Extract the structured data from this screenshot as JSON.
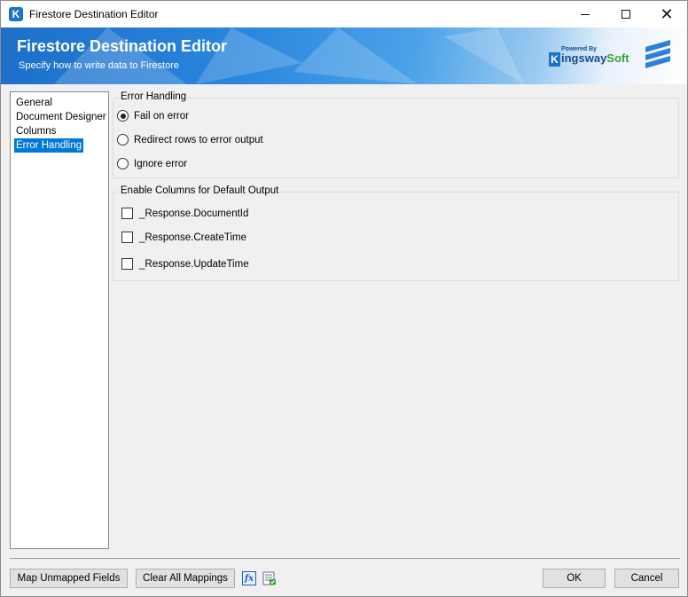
{
  "window": {
    "title": "Firestore Destination Editor",
    "app_icon_letter": "K",
    "controls": {
      "minimize": "—",
      "maximize": "☐",
      "close": "✕"
    }
  },
  "banner": {
    "title": "Firestore Destination Editor",
    "subtitle": "Specify how to write data to Firestore",
    "brand_powered": "Powered By",
    "brand_k": "K",
    "brand_name_a": "ingsway",
    "brand_name_b": "Soft"
  },
  "nav": {
    "items": [
      {
        "label": "General",
        "selected": false
      },
      {
        "label": "Document Designer",
        "selected": false
      },
      {
        "label": "Columns",
        "selected": false
      },
      {
        "label": "Error Handling",
        "selected": true
      }
    ]
  },
  "error_handling": {
    "legend": "Error Handling",
    "options": [
      {
        "label": "Fail on error",
        "checked": true
      },
      {
        "label": "Redirect rows to error output",
        "checked": false
      },
      {
        "label": "Ignore error",
        "checked": false
      }
    ]
  },
  "default_output": {
    "legend": "Enable Columns for Default Output",
    "columns": [
      {
        "label": "_Response.DocumentId",
        "checked": false
      },
      {
        "label": "_Response.CreateTime",
        "checked": false
      },
      {
        "label": "_Response.UpdateTime",
        "checked": false
      }
    ]
  },
  "footer": {
    "map_unmapped": "Map Unmapped Fields",
    "clear_mappings": "Clear All Mappings",
    "fx_icon_text": "fx",
    "ok": "OK",
    "cancel": "Cancel"
  },
  "colors": {
    "accent": "#0078d7",
    "banner_blue": "#1d6fc8",
    "brand_green": "#3aa03a"
  }
}
